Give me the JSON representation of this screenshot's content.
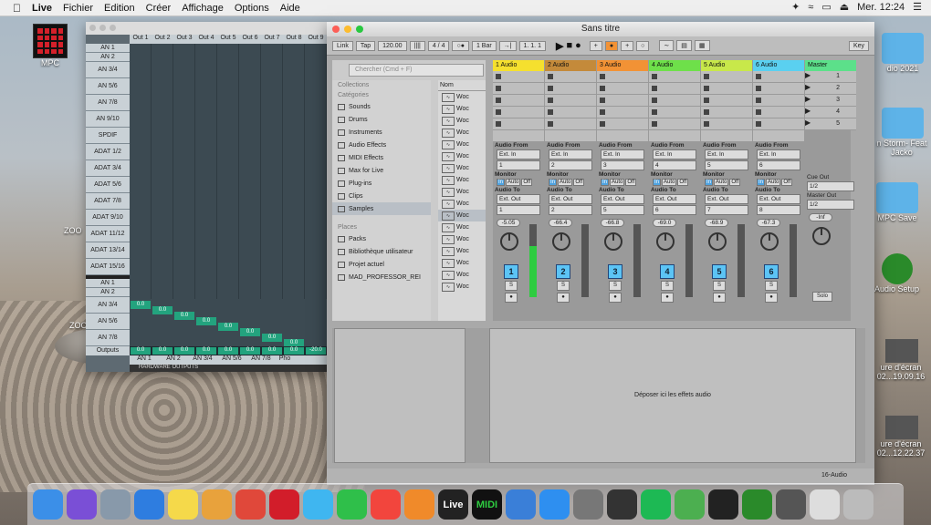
{
  "menubar": {
    "app": "Live",
    "items": [
      "Fichier",
      "Edition",
      "Créer",
      "Affichage",
      "Options",
      "Aide"
    ],
    "clock": "Mer. 12:24"
  },
  "desktop": {
    "left_icons": [
      "MPC"
    ],
    "right_icons": [
      "dio 2021",
      "n Storm- Feat Jacko",
      "MPC Save",
      "Audio Setup",
      "ure d'écran 02...19.09.16",
      "ure d'écran 02...12.22.37"
    ],
    "zoom_labels": [
      "ZOO",
      "ZOO"
    ]
  },
  "io_window": {
    "col_headers": [
      "Out 1",
      "Out 2",
      "Out 3",
      "Out 4",
      "Out 5",
      "Out 6",
      "Out 7",
      "Out 8",
      "Out 9"
    ],
    "top_rows": [
      "AN 1",
      "AN 2",
      "AN 3/4",
      "AN 5/6",
      "AN 7/8",
      "AN 9/10",
      "SPDIF",
      "ADAT 1/2",
      "ADAT 3/4",
      "ADAT 5/6",
      "ADAT 7/8",
      "ADAT 9/10",
      "ADAT 11/12",
      "ADAT 13/14",
      "ADAT 15/16"
    ],
    "bottom_rows": [
      "AN 1",
      "AN 2",
      "AN 3/4",
      "AN 5/6",
      "AN 7/8"
    ],
    "diag_value": "0.0",
    "outputs_label": "Outputs",
    "outputs_values": [
      "0.0",
      "0.0",
      "0.0",
      "0.0",
      "0.0",
      "0.0",
      "0.0",
      "0.0",
      "-20.0"
    ],
    "bottom_labels": [
      "AN 1",
      "AN 2",
      "AN 3/4",
      "AN 5/6",
      "AN 7/8",
      "Pho"
    ],
    "footer": "HARDWARE OUTPUTS"
  },
  "live": {
    "title": "Sans titre",
    "transport": {
      "link": "Link",
      "tap": "Tap",
      "tempo": "120.00",
      "signature": "4 / 4",
      "quant": "1 Bar",
      "position": "1.   1.   1",
      "key": "Key"
    },
    "browser": {
      "search_placeholder": "Chercher (Cmd + F)",
      "collections": "Collections",
      "categories_label": "Catégories",
      "categories": [
        "Sounds",
        "Drums",
        "Instruments",
        "Audio Effects",
        "MIDI Effects",
        "Max for Live",
        "Plug-ins",
        "Clips",
        "Samples"
      ],
      "places_label": "Places",
      "places": [
        "Packs",
        "Bibliothèque utilisateur",
        "Projet actuel",
        "MAD_PROFESSOR_REI"
      ],
      "name_header": "Nom",
      "file_label": "Woc"
    },
    "tracks": [
      {
        "name": "1 Audio",
        "color": "#f5e02e",
        "from_sel": "Ext. In",
        "chan": "1",
        "to_sel": "Ext. Out",
        "out": "1",
        "vol": "-5.05",
        "num": "1"
      },
      {
        "name": "2 Audio",
        "color": "#c48a3a",
        "from_sel": "Ext. In",
        "chan": "2",
        "to_sel": "Ext. Out",
        "out": "2",
        "vol": "-66.4",
        "num": "2"
      },
      {
        "name": "3 Audio",
        "color": "#f29235",
        "from_sel": "Ext. In",
        "chan": "3",
        "to_sel": "Ext. Out",
        "out": "5",
        "vol": "-66.8",
        "num": "3"
      },
      {
        "name": "4 Audio",
        "color": "#6ee04a",
        "from_sel": "Ext. In",
        "chan": "4",
        "to_sel": "Ext. Out",
        "out": "6",
        "vol": "-69.0",
        "num": "4"
      },
      {
        "name": "5 Audio",
        "color": "#c8e84a",
        "from_sel": "Ext. In",
        "chan": "5",
        "to_sel": "Ext. Out",
        "out": "7",
        "vol": "-68.9",
        "num": "5"
      },
      {
        "name": "6 Audio",
        "color": "#5ad0f0",
        "from_sel": "Ext. In",
        "chan": "6",
        "to_sel": "Ext. Out",
        "out": "8",
        "vol": "-67.3",
        "num": "6"
      }
    ],
    "io_labels": {
      "audio_from": "Audio From",
      "monitor": "Monitor",
      "audio_to": "Audio To",
      "mon_in": "In",
      "mon_auto": "Auto",
      "mon_off": "Off",
      "solo": "S"
    },
    "master": {
      "name": "Master",
      "scenes": [
        "1",
        "2",
        "3",
        "4",
        "5"
      ],
      "cue_out": "Cue Out",
      "cue_sel": "1/2",
      "master_out": "Master Out",
      "master_sel": "1/2",
      "vol": "-Inf",
      "solo": "Solo"
    },
    "drop_text": "Déposer ici les effets audio",
    "status_right": "16-Audio"
  },
  "dock": {
    "items": [
      "finder",
      "siri",
      "launchpad",
      "safari",
      "notes",
      "photos",
      "chrome",
      "opera",
      "messages",
      "facetime",
      "music",
      "books",
      "Live",
      "MIDI",
      "mpc",
      "appstore",
      "prefs",
      "keyboard",
      "spotify",
      "utorrent",
      "splice",
      "mpc2",
      "rme",
      "preview",
      "trash"
    ],
    "live_label": "Live",
    "midi_label": "MIDI",
    "badge": "1"
  }
}
